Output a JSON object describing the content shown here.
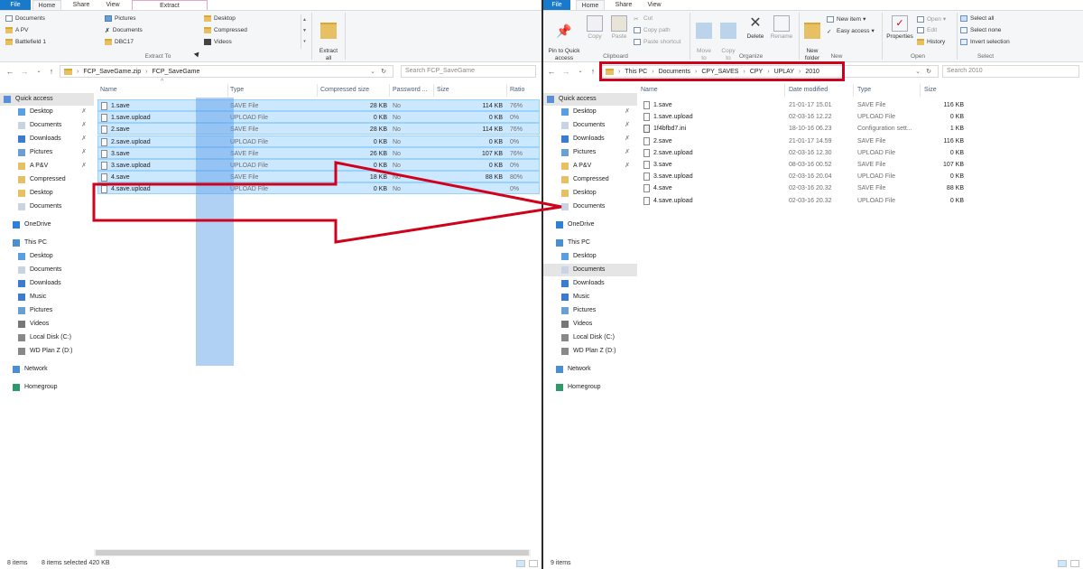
{
  "left": {
    "tabs": [
      "File",
      "Home",
      "Share",
      "View",
      "Extract"
    ],
    "extract_col1": [
      "Documents",
      "A PV",
      "Battlefield 1"
    ],
    "extract_col2": [
      "Pictures",
      "Documents",
      "DBC17"
    ],
    "extract_col3": [
      "Desktop",
      "Compressed",
      "Videos"
    ],
    "extract_all": "Extract\nall",
    "extract_to": "Extract To",
    "path": [
      "FCP_SaveGame.zip",
      "FCP_SaveGame"
    ],
    "search_placeholder": "Search FCP_SaveGame",
    "columns": [
      "Name",
      "Type",
      "Compressed size",
      "Password ...",
      "Size",
      "Ratio"
    ],
    "files": [
      {
        "name": "1.save",
        "type": "SAVE File",
        "csize": "28 KB",
        "pwd": "No",
        "size": "114 KB",
        "ratio": "76%"
      },
      {
        "name": "1.save.upload",
        "type": "UPLOAD File",
        "csize": "0 KB",
        "pwd": "No",
        "size": "0 KB",
        "ratio": "0%"
      },
      {
        "name": "2.save",
        "type": "SAVE File",
        "csize": "28 KB",
        "pwd": "No",
        "size": "114 KB",
        "ratio": "76%"
      },
      {
        "name": "2.save.upload",
        "type": "UPLOAD File",
        "csize": "0 KB",
        "pwd": "No",
        "size": "0 KB",
        "ratio": "0%"
      },
      {
        "name": "3.save",
        "type": "SAVE File",
        "csize": "26 KB",
        "pwd": "No",
        "size": "107 KB",
        "ratio": "76%"
      },
      {
        "name": "3.save.upload",
        "type": "UPLOAD File",
        "csize": "0 KB",
        "pwd": "No",
        "size": "0 KB",
        "ratio": "0%"
      },
      {
        "name": "4.save",
        "type": "SAVE File",
        "csize": "18 KB",
        "pwd": "No",
        "size": "88 KB",
        "ratio": "80%"
      },
      {
        "name": "4.save.upload",
        "type": "UPLOAD File",
        "csize": "0 KB",
        "pwd": "No",
        "size": "",
        "ratio": "0%"
      }
    ],
    "status_items": "8 items",
    "status_selected": "8 items selected  420 KB"
  },
  "right": {
    "tabs": [
      "File",
      "Home",
      "Share",
      "View"
    ],
    "clipboard": {
      "pin": "Pin to Quick\naccess",
      "copy": "Copy",
      "paste": "Paste",
      "cut": "Cut",
      "copy_path": "Copy path",
      "paste_shortcut": "Paste shortcut",
      "label": "Clipboard"
    },
    "organize": {
      "move_to": "Move\nto",
      "copy_to": "Copy\nto",
      "delete": "Delete",
      "rename": "Rename",
      "label": "Organize"
    },
    "new": {
      "new_folder": "New\nfolder",
      "new_item": "New item",
      "easy_access": "Easy access",
      "label": "New"
    },
    "open": {
      "properties": "Properties",
      "open": "Open",
      "edit": "Edit",
      "history": "History",
      "label": "Open"
    },
    "select": {
      "select_all": "Select all",
      "select_none": "Select none",
      "invert": "Invert selection",
      "label": "Select"
    },
    "path": [
      "This PC",
      "Documents",
      "CPY_SAVES",
      "CPY",
      "UPLAY",
      "2010"
    ],
    "search_placeholder": "Search 2010",
    "columns": [
      "Name",
      "Date modified",
      "Type",
      "Size"
    ],
    "files": [
      {
        "name": "1.save",
        "date": "21-01-17 15.01",
        "type": "SAVE File",
        "size": "116 KB"
      },
      {
        "name": "1.save.upload",
        "date": "02-03-16 12.22",
        "type": "UPLOAD File",
        "size": "0 KB"
      },
      {
        "name": "1f4bfbd7.ini",
        "date": "18-10-16 06.23",
        "type": "Configuration sett...",
        "size": "1 KB"
      },
      {
        "name": "2.save",
        "date": "21-01-17 14.59",
        "type": "SAVE File",
        "size": "116 KB"
      },
      {
        "name": "2.save.upload",
        "date": "02-03-16 12.30",
        "type": "UPLOAD File",
        "size": "0 KB"
      },
      {
        "name": "3.save",
        "date": "08-03-16 00.52",
        "type": "SAVE File",
        "size": "107 KB"
      },
      {
        "name": "3.save.upload",
        "date": "02-03-16 20.04",
        "type": "UPLOAD File",
        "size": "0 KB"
      },
      {
        "name": "4.save",
        "date": "02-03-16 20.32",
        "type": "SAVE File",
        "size": "88 KB"
      },
      {
        "name": "4.save.upload",
        "date": "02-03-16 20.32",
        "type": "UPLOAD File",
        "size": "0 KB"
      }
    ],
    "status_items": "9 items"
  },
  "nav": {
    "quick_access": "Quick access",
    "qa_items": [
      "Desktop",
      "Documents",
      "Downloads",
      "Pictures",
      "A P&V",
      "Compressed",
      "Desktop",
      "Documents"
    ],
    "onedrive": "OneDrive",
    "this_pc": "This PC",
    "pc_items": [
      "Desktop",
      "Documents",
      "Downloads",
      "Music",
      "Pictures",
      "Videos",
      "Local Disk (C:)",
      "WD Plan Z  (D:)"
    ],
    "network": "Network",
    "homegroup": "Homegroup"
  },
  "colors": {
    "accent": "#1979ca",
    "selection": "#cce8ff",
    "annotation_red": "#d0021b"
  }
}
